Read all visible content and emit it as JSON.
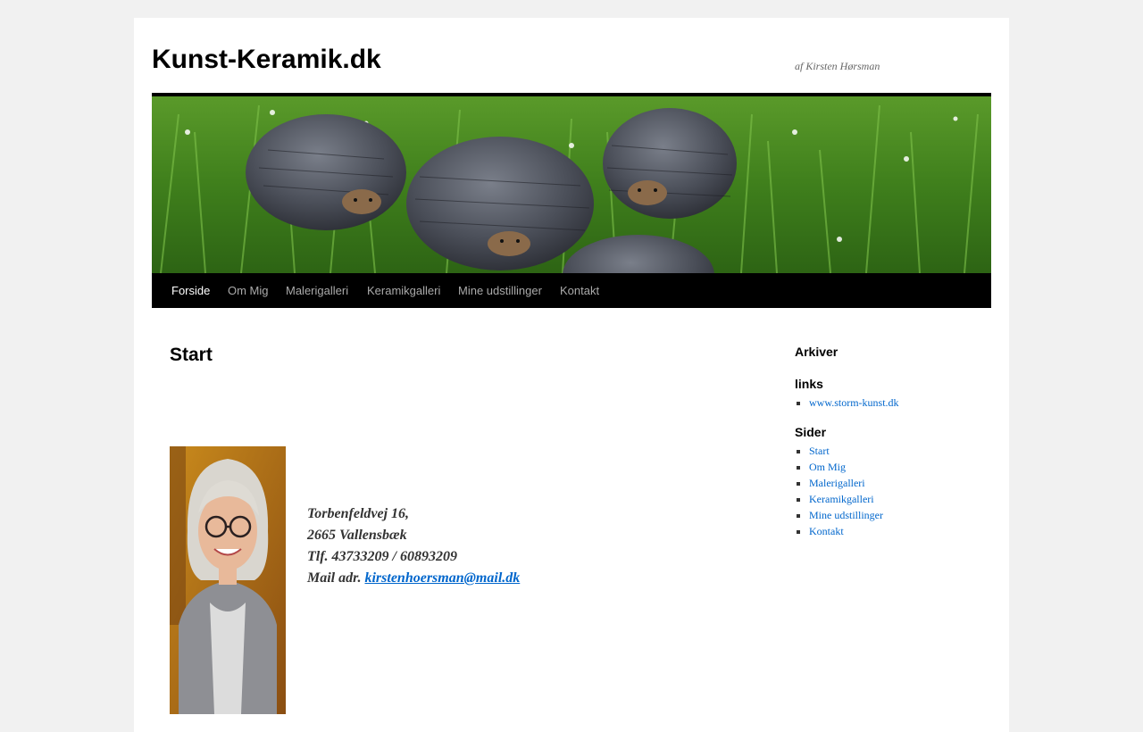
{
  "site": {
    "title": "Kunst-Keramik.dk",
    "description": "af Kirsten Hørsman"
  },
  "nav": {
    "items": [
      {
        "label": "Forside",
        "current": true
      },
      {
        "label": "Om Mig",
        "current": false
      },
      {
        "label": "Malerigalleri",
        "current": false
      },
      {
        "label": "Keramikgalleri",
        "current": false
      },
      {
        "label": "Mine udstillinger",
        "current": false
      },
      {
        "label": "Kontakt",
        "current": false
      }
    ]
  },
  "main": {
    "title": "Start",
    "address": {
      "street": "Torbenfeldvej 16,",
      "city": "2665 Vallensbæk",
      "phone": "Tlf. 43733209 / 60893209",
      "mail_label": "Mail adr. ",
      "mail_link": "kirstenhoersman@mail.dk"
    }
  },
  "sidebar": {
    "archives_title": "Arkiver",
    "links_title": "links",
    "links": [
      "www.storm-kunst.dk"
    ],
    "pages_title": "Sider",
    "pages": [
      "Start",
      "Om Mig",
      "Malerigalleri",
      "Keramikgalleri",
      "Mine udstillinger",
      "Kontakt"
    ]
  },
  "colors": {
    "link": "#0066cc",
    "nav_bg": "#000000",
    "page_bg": "#f1f1f1"
  }
}
